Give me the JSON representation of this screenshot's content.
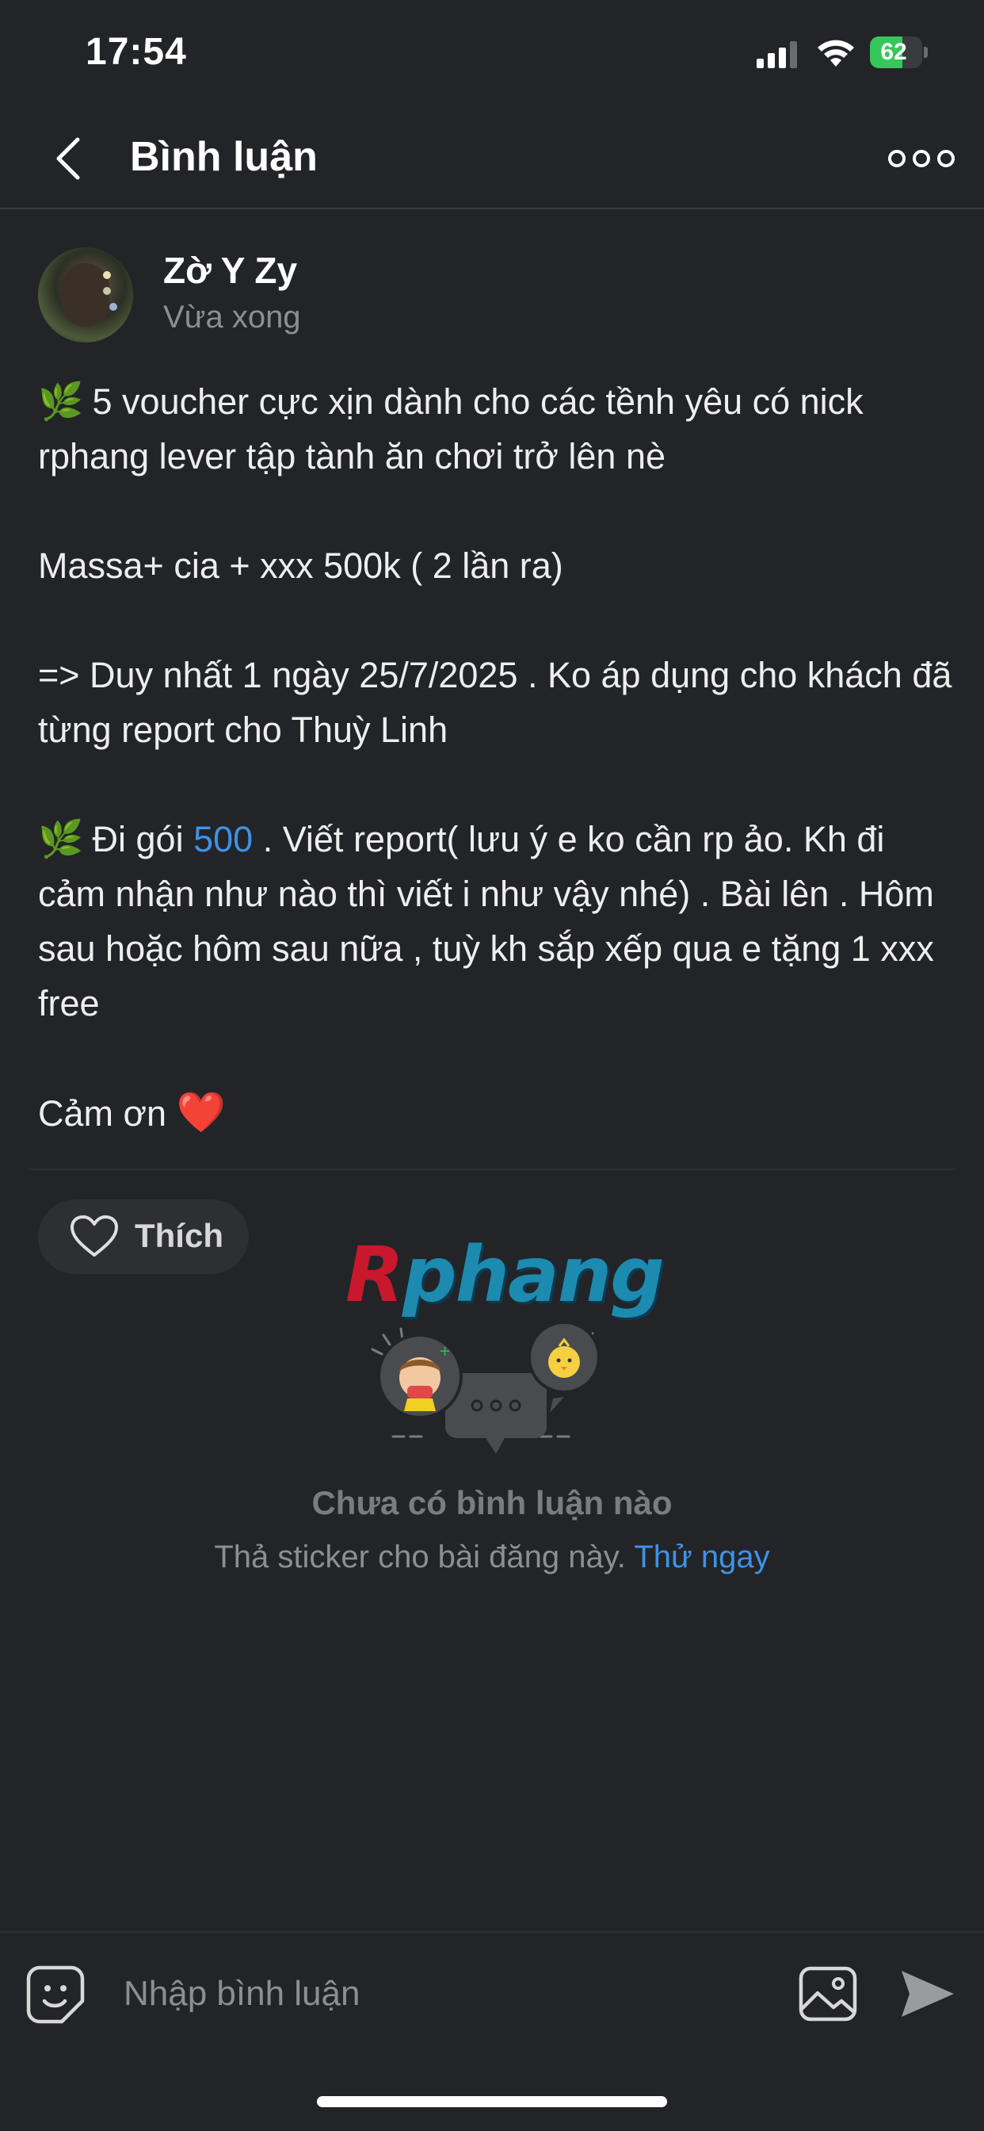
{
  "status_bar": {
    "time": "17:54",
    "battery_percent": "62",
    "battery_level": 0.62,
    "battery_color": "#35c759",
    "icons": [
      "cellular-signal-icon",
      "wifi-icon",
      "battery-charging-icon"
    ]
  },
  "nav": {
    "title": "Bình luận",
    "back_icon": "chevron-left-icon",
    "more_icon": "more-options-icon"
  },
  "post": {
    "author": "Zờ Y Zy",
    "time": "Vừa xong",
    "leaf_emoji": "🌿",
    "paragraph_1": "5 voucher cực xịn dành cho các tềnh yêu có nick rphang lever tập tành ăn chơi trở lên nè",
    "paragraph_2": "Massa+ cia + xxx 500k ( 2 lần ra)",
    "paragraph_3": "=> Duy nhất 1 ngày 25/7/2025 . Ko áp dụng cho khách đã từng report cho Thuỳ Linh",
    "paragraph_4_pre": "Đi gói",
    "paragraph_4_link": "500",
    "paragraph_4_post": ". Viết report( lưu ý e ko cần rp ảo. Kh đi cảm nhận như nào thì viết i như vậy nhé) . Bài lên . Hôm sau hoặc hôm sau nữa , tuỳ kh sắp xếp qua e tặng 1 xxx free",
    "paragraph_5": "Cảm ơn",
    "heart_emoji": "❤️",
    "watermark_r": "R",
    "watermark_rest": "phang"
  },
  "actions": {
    "like_label": "Thích",
    "like_icon": "heart-outline-icon"
  },
  "comments_empty": {
    "title": "Chưa có bình luận nào",
    "subtitle": "Thả sticker cho bài đăng này.",
    "cta": "Thử ngay",
    "illustration": "chat-bubbles-stickers-illustration"
  },
  "composer": {
    "placeholder": "Nhập bình luận",
    "sticker_icon": "smiley-sticker-icon",
    "image_icon": "image-icon",
    "send_icon": "send-icon"
  },
  "colors": {
    "background": "#232427",
    "accent_link": "#3d92e8",
    "muted_text": "#8d8e92"
  }
}
